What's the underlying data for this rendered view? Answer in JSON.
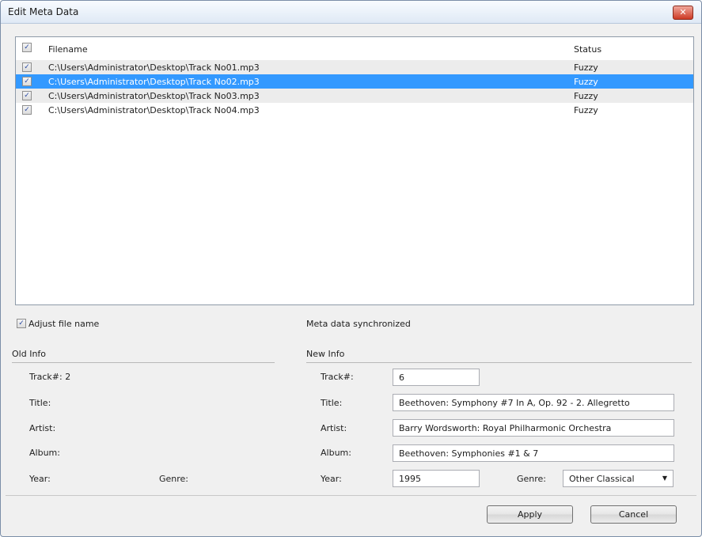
{
  "window": {
    "title": "Edit Meta Data",
    "close_glyph": "✕"
  },
  "list": {
    "header": {
      "filename": "Filename",
      "status": "Status"
    },
    "rows": [
      {
        "filename": "C:\\Users\\Administrator\\Desktop\\Track No01.mp3",
        "status": "Fuzzy",
        "checked": true
      },
      {
        "filename": "C:\\Users\\Administrator\\Desktop\\Track No02.mp3",
        "status": "Fuzzy",
        "checked": true,
        "selected": true
      },
      {
        "filename": "C:\\Users\\Administrator\\Desktop\\Track No03.mp3",
        "status": "Fuzzy",
        "checked": true
      },
      {
        "filename": "C:\\Users\\Administrator\\Desktop\\Track No04.mp3",
        "status": "Fuzzy",
        "checked": true
      }
    ],
    "check_glyph": "✓"
  },
  "options": {
    "adjust_file_name": "Adjust file name",
    "sync_status": "Meta data synchronized"
  },
  "old_info": {
    "heading": "Old Info",
    "track_label": "Track#: 2",
    "title_label": "Title:",
    "artist_label": "Artist:",
    "album_label": "Album:",
    "year_label": "Year:",
    "genre_label": "Genre:"
  },
  "new_info": {
    "heading": "New Info",
    "track_label": "Track#:",
    "track_value": "6",
    "title_label": "Title:",
    "title_value": "Beethoven: Symphony #7 In A, Op. 92 - 2. Allegretto",
    "artist_label": "Artist:",
    "artist_value": "Barry Wordsworth: Royal Philharmonic Orchestra",
    "album_label": "Album:",
    "album_value": "Beethoven: Symphonies #1 & 7",
    "year_label": "Year:",
    "year_value": "1995",
    "genre_label": "Genre:",
    "genre_value": "Other Classical",
    "combo_arrow": "▼"
  },
  "buttons": {
    "apply": "Apply",
    "cancel": "Cancel"
  },
  "colors": {
    "selection": "#3399ff",
    "accent": "#cd3a24"
  }
}
